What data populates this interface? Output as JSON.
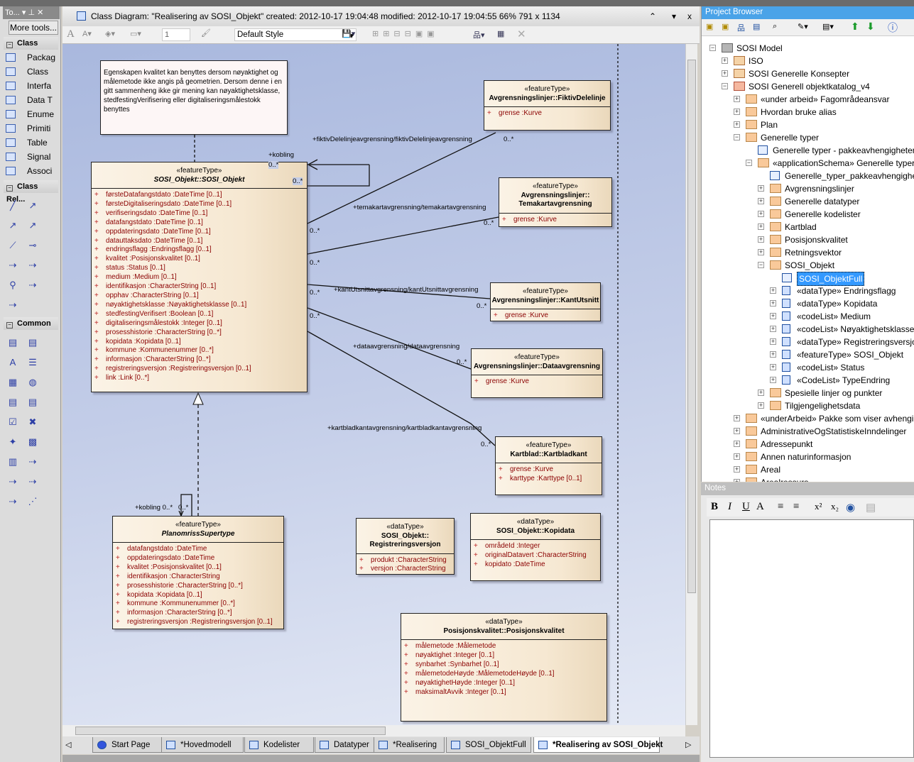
{
  "toolbox": {
    "title": "To...",
    "more_tools": "More tools...",
    "sections": [
      {
        "label": "Class",
        "items": [
          "Packag",
          "Class",
          "Interfa",
          "Data T",
          "Enume",
          "Primiti",
          "Table",
          "Signal",
          "Associ"
        ]
      },
      {
        "label": "Class Rel..."
      },
      {
        "label": "Common"
      }
    ]
  },
  "diagram": {
    "title": "Class Diagram: \"Realisering av SOSI_Objekt\"   created: 2012-10-17 19:04:48  modified: 2012-10-17 19:04:55   66%   791 x 1134",
    "toolbar": {
      "line_width": "1",
      "style": "Default Style"
    },
    "note": "Egenskapen kvalitet kan benyttes dersom nøyaktighet og målemetode ikke angis på geometrien. Dersom denne i en gitt sammenheng ikke gir mening kan nøyaktighetsklasse, stedfestingVerifisering eller digitaliseringsmålestokk benyttes",
    "classes": [
      {
        "id": "sosi",
        "stereotype": "«featureType»",
        "name": "SOSI_Objekt::SOSI_Objekt",
        "italic": true,
        "attributes": [
          "førsteDatafangstdato  :DateTime [0..1]",
          "førsteDigitaliseringsdato  :DateTime [0..1]",
          "verifiseringsdato  :DateTime [0..1]",
          "datafangstdato  :DateTime [0..1]",
          "oppdateringsdato  :DateTime [0..1]",
          "datauttaksdato  :DateTime [0..1]",
          "endringsflagg  :Endringsflagg [0..1]",
          "kvalitet  :Posisjonskvalitet [0..1]",
          "status  :Status [0..1]",
          "medium  :Medium [0..1]",
          "identifikasjon  :CharacterString [0..1]",
          "opphav  :CharacterString [0..1]",
          "nøyaktighetsklasse  :Nøyaktighetsklasse [0..1]",
          "stedfestingVerifisert  :Boolean [0..1]",
          "digitaliseringsmålestokk  :Integer [0..1]",
          "prosesshistorie  :CharacterString [0..*]",
          "kopidata  :Kopidata [0..1]",
          "kommune  :Kommunenummer [0..*]",
          "informasjon  :CharacterString [0..*]",
          "registreringsversjon  :Registreringsversjon [0..1]",
          "link  :Link [0..*]"
        ]
      },
      {
        "id": "fiktiv",
        "stereotype": "«featureType»",
        "name": "Avgrensningslinjer::FiktivDelelinje",
        "attributes": [
          "grense  :Kurve"
        ]
      },
      {
        "id": "tema",
        "stereotype": "«featureType»",
        "name": "Avgrensningslinjer::\nTemakartavgrensning",
        "attributes": [
          "grense  :Kurve"
        ]
      },
      {
        "id": "kant",
        "stereotype": "«featureType»",
        "name": "Avgrensningslinjer::KantUtsnitt",
        "attributes": [
          "grense  :Kurve"
        ]
      },
      {
        "id": "data",
        "stereotype": "«featureType»",
        "name": "Avgrensningslinjer::Dataavgrensning",
        "attributes": [
          "grense  :Kurve"
        ]
      },
      {
        "id": "kartblad",
        "stereotype": "«featureType»",
        "name": "Kartblad::Kartbladkant",
        "attributes": [
          "grense  :Kurve",
          "karttype  :Karttype [0..1]"
        ]
      },
      {
        "id": "planomriss",
        "stereotype": "«featureType»",
        "name": "PlanomrissSupertype",
        "italic": true,
        "attributes": [
          "datafangstdato  :DateTime",
          "oppdateringsdato  :DateTime",
          "kvalitet  :Posisjonskvalitet [0..1]",
          "identifikasjon  :CharacterString",
          "prosesshistorie  :CharacterString [0..*]",
          "kopidata  :Kopidata [0..1]",
          "kommune  :Kommunenummer [0..*]",
          "informasjon  :CharacterString [0..*]",
          "registreringsversjon  :Registreringsversjon [0..1]"
        ]
      },
      {
        "id": "regver",
        "stereotype": "«dataType»",
        "name": "SOSI_Objekt::\nRegistreringsversjon",
        "attributes": [
          "produkt  :CharacterString",
          "versjon  :CharacterString"
        ]
      },
      {
        "id": "kopidata",
        "stereotype": "«dataType»",
        "name": "SOSI_Objekt::Kopidata",
        "attributes": [
          "områdeId  :Integer",
          "originalDatavert  :CharacterString",
          "kopidato  :DateTime"
        ]
      },
      {
        "id": "poskval",
        "stereotype": "«dataType»",
        "name": "Posisjonskvalitet::Posisjonskvalitet",
        "attributes": [
          "målemetode  :Målemetode",
          "nøyaktighet  :Integer [0..1]",
          "synbarhet  :Synbarhet [0..1]",
          "målemetodeHøyde  :MålemetodeHøyde [0..1]",
          "nøyaktighetHøyde  :Integer [0..1]",
          "maksimaltAvvik  :Integer [0..1]"
        ]
      }
    ],
    "labels": {
      "kobling_role": "+kobling",
      "kobling_mult": "0..*",
      "kobling_mult2": "0..*",
      "fiktiv_role": "+fiktivDelelinjeavgrensning/fiktivDelelinjeavgrensning",
      "fiktiv_mult": "0..*",
      "fiktiv_src": "0..*",
      "tema_role": "+temakartavgrensning/temakartavgrensning",
      "tema_mult": "0..*",
      "tema_src": "0..*",
      "kant_role": "+kantUtsnittavgrensning/kantUtsnittavgrensning",
      "kant_mult": "0..*",
      "kant_src": "0..*",
      "data_role": "+dataavgrensning/dataavgrensning",
      "data_mult": "0..*",
      "data_src": "0..*",
      "kartblad_role": "+kartbladkantavgrensning/kartbladkantavgrensning",
      "kartblad_mult": "0..*",
      "plan_kobling": "+kobling 0..*",
      "plan_mult": "0..*"
    }
  },
  "tabs": [
    {
      "label": "Start Page",
      "active": false
    },
    {
      "label": "*Hovedmodell",
      "active": false
    },
    {
      "label": "Kodelister",
      "active": false
    },
    {
      "label": "Datatyper",
      "active": false
    },
    {
      "label": "*Realisering",
      "active": false
    },
    {
      "label": "SOSI_ObjektFull",
      "active": false
    },
    {
      "label": "*Realisering av SOSI_Objekt",
      "active": true
    }
  ],
  "project_browser": {
    "title": "Project Browser",
    "tree": [
      {
        "label": "SOSI Model",
        "depth": 0,
        "exp": "-",
        "icon": "model"
      },
      {
        "label": "ISO",
        "depth": 1,
        "exp": "+",
        "icon": "pkg-blue"
      },
      {
        "label": "SOSI Generelle Konsepter",
        "depth": 1,
        "exp": "+",
        "icon": "pkg-blue"
      },
      {
        "label": "SOSI Generell objektkatalog_v4",
        "depth": 1,
        "exp": "-",
        "icon": "pkg-red"
      },
      {
        "label": "«under arbeid» Fagområdeansvar",
        "depth": 2,
        "exp": "+",
        "icon": "folder"
      },
      {
        "label": "Hvordan bruke alias",
        "depth": 2,
        "exp": "+",
        "icon": "folder"
      },
      {
        "label": "Plan",
        "depth": 2,
        "exp": "+",
        "icon": "folder"
      },
      {
        "label": "Generelle typer",
        "depth": 2,
        "exp": "-",
        "icon": "folder"
      },
      {
        "label": "Generelle typer - pakkeavhengigheter",
        "depth": 3,
        "exp": "",
        "icon": "diagram"
      },
      {
        "label": "«applicationSchema» Generelle typer 4",
        "depth": 3,
        "exp": "-",
        "icon": "folder"
      },
      {
        "label": "Generelle_typer_pakkeavhengigheter",
        "depth": 4,
        "exp": "",
        "icon": "diagram"
      },
      {
        "label": "Avgrensningslinjer",
        "depth": 4,
        "exp": "+",
        "icon": "folder"
      },
      {
        "label": "Generelle datatyper",
        "depth": 4,
        "exp": "+",
        "icon": "folder"
      },
      {
        "label": "Generelle kodelister",
        "depth": 4,
        "exp": "+",
        "icon": "folder"
      },
      {
        "label": "Kartblad",
        "depth": 4,
        "exp": "+",
        "icon": "folder"
      },
      {
        "label": "Posisjonskvalitet",
        "depth": 4,
        "exp": "+",
        "icon": "folder"
      },
      {
        "label": "Retningsvektor",
        "depth": 4,
        "exp": "+",
        "icon": "folder"
      },
      {
        "label": "SOSI_Objekt",
        "depth": 4,
        "exp": "-",
        "icon": "folder"
      },
      {
        "label": "SOSI_ObjektFull",
        "depth": 5,
        "exp": "",
        "icon": "diagram",
        "selected": true
      },
      {
        "label": "«dataType» Endringsflagg",
        "depth": 5,
        "exp": "+",
        "icon": "class"
      },
      {
        "label": "«dataType» Kopidata",
        "depth": 5,
        "exp": "+",
        "icon": "class"
      },
      {
        "label": "«codeList» Medium",
        "depth": 5,
        "exp": "+",
        "icon": "class"
      },
      {
        "label": "«codeList» Nøyaktighetsklasse",
        "depth": 5,
        "exp": "+",
        "icon": "class"
      },
      {
        "label": "«dataType» Registreringsversjon",
        "depth": 5,
        "exp": "+",
        "icon": "class"
      },
      {
        "label": "«featureType» SOSI_Objekt",
        "depth": 5,
        "exp": "+",
        "icon": "class"
      },
      {
        "label": "«codeList» Status",
        "depth": 5,
        "exp": "+",
        "icon": "class"
      },
      {
        "label": "«CodeList» TypeEndring",
        "depth": 5,
        "exp": "+",
        "icon": "class"
      },
      {
        "label": "Spesielle linjer og punkter",
        "depth": 4,
        "exp": "+",
        "icon": "folder"
      },
      {
        "label": "Tilgjengelighetsdata",
        "depth": 4,
        "exp": "+",
        "icon": "folder"
      },
      {
        "label": "«underArbeid» Pakke som viser avhengig",
        "depth": 2,
        "exp": "+",
        "icon": "folder"
      },
      {
        "label": "AdministrativeOgStatistiskeInndelinger",
        "depth": 2,
        "exp": "+",
        "icon": "folder"
      },
      {
        "label": "Adressepunkt",
        "depth": 2,
        "exp": "+",
        "icon": "folder"
      },
      {
        "label": "Annen naturinformasjon",
        "depth": 2,
        "exp": "+",
        "icon": "folder"
      },
      {
        "label": "Areal",
        "depth": 2,
        "exp": "+",
        "icon": "folder"
      },
      {
        "label": "Arealressurs",
        "depth": 2,
        "exp": "+",
        "icon": "folder"
      }
    ]
  },
  "notes": {
    "title": "Notes",
    "tools": [
      "B",
      "I",
      "U",
      "A",
      "≡",
      "≡",
      "x²",
      "x₂"
    ]
  }
}
